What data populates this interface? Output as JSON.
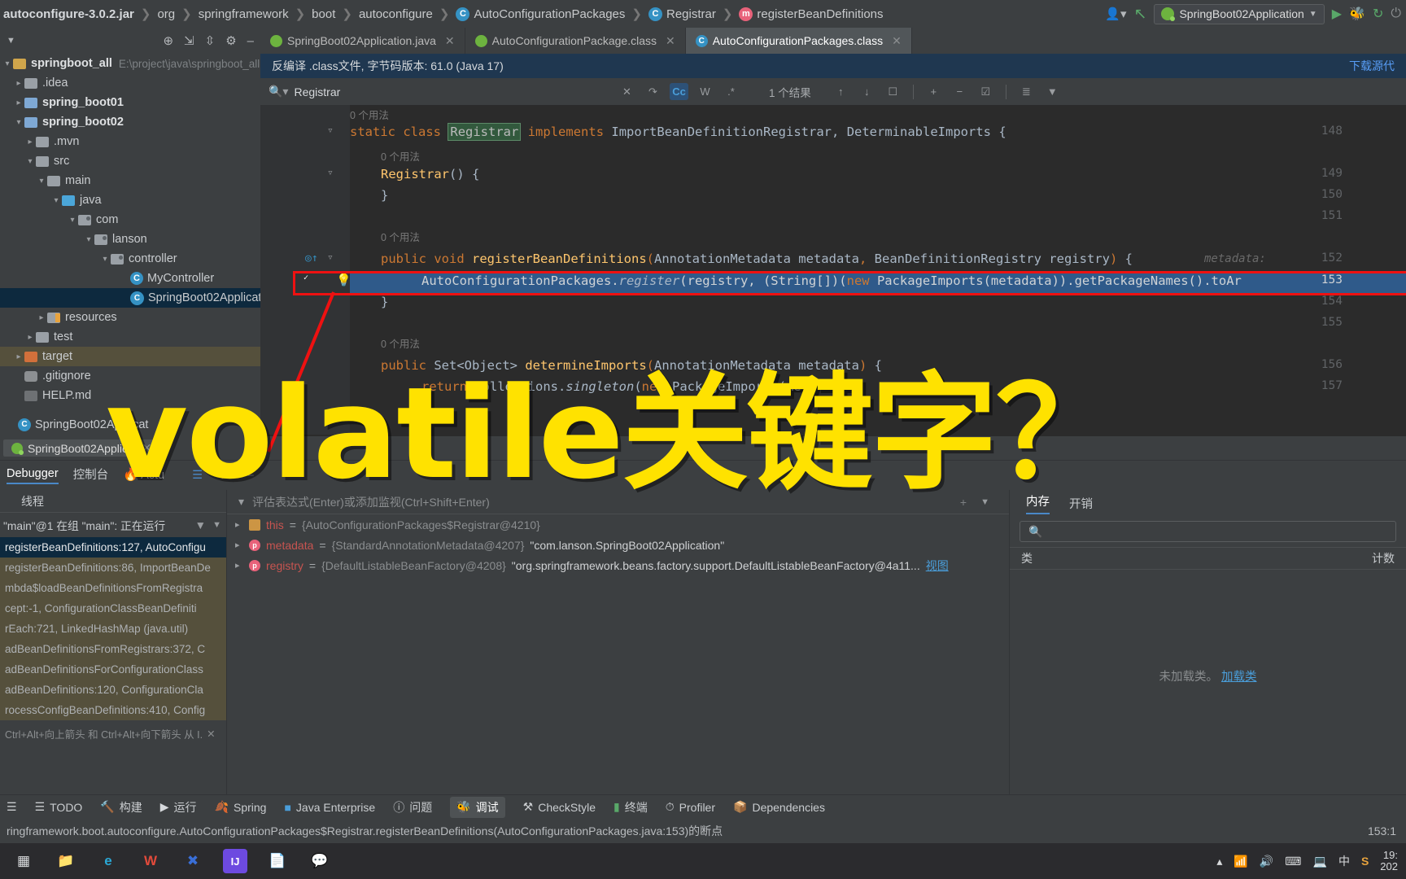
{
  "breadcrumb": [
    {
      "label": "autoconfigure-3.0.2.jar",
      "icon": "jar-icon",
      "bold": true
    },
    {
      "label": "org",
      "icon": "package-icon"
    },
    {
      "label": "springframework",
      "icon": "package-icon"
    },
    {
      "label": "boot",
      "icon": "package-icon"
    },
    {
      "label": "autoconfigure",
      "icon": "package-icon"
    },
    {
      "label": "AutoConfigurationPackages",
      "icon": "class-icon"
    },
    {
      "label": "Registrar",
      "icon": "class-icon"
    },
    {
      "label": "registerBeanDefinitions",
      "icon": "method-icon"
    }
  ],
  "topbar_right": {
    "profile_icon": "user-icon",
    "back_icon": "back-arrow-icon",
    "run_config": "SpringBoot02Application",
    "run_icon": "run-icon",
    "debug_icon": "debug-icon",
    "rerun_icon": "rerun-icon",
    "stop_icon": "stop-icon"
  },
  "tabs": [
    {
      "label": "SpringBoot02Application.java",
      "icon": "spring-class-icon",
      "active": false
    },
    {
      "label": "AutoConfigurationPackage.class",
      "icon": "annotation-icon",
      "active": false
    },
    {
      "label": "AutoConfigurationPackages.class",
      "icon": "class-icon",
      "active": true
    }
  ],
  "project_tree": {
    "toolbar_icons": [
      "collapse-icon",
      "scroll-from-source-icon",
      "expand-icon",
      "settings-gear-icon",
      "hide-icon"
    ],
    "items": [
      {
        "label": "springboot_all",
        "path": "E:\\project\\java\\springboot_all",
        "indent": 0,
        "arrow": "down",
        "icon": "project-icon",
        "bold": true
      },
      {
        "label": ".idea",
        "indent": 1,
        "arrow": "right",
        "icon": "folder-icon"
      },
      {
        "label": "spring_boot01",
        "indent": 1,
        "arrow": "right",
        "icon": "module-icon",
        "bold": true
      },
      {
        "label": "spring_boot02",
        "indent": 1,
        "arrow": "down",
        "icon": "module-icon",
        "bold": true
      },
      {
        "label": ".mvn",
        "indent": 2,
        "arrow": "right",
        "icon": "folder-icon"
      },
      {
        "label": "src",
        "indent": 2,
        "arrow": "down",
        "icon": "folder-icon"
      },
      {
        "label": "main",
        "indent": 3,
        "arrow": "down",
        "icon": "folder-icon"
      },
      {
        "label": "java",
        "indent": 4,
        "arrow": "down",
        "icon": "source-folder-icon"
      },
      {
        "label": "com",
        "indent": 5,
        "arrow": "down",
        "icon": "package-folder-icon"
      },
      {
        "label": "lanson",
        "indent": 6,
        "arrow": "down",
        "icon": "package-folder-icon"
      },
      {
        "label": "controller",
        "indent": 7,
        "arrow": "down",
        "icon": "package-folder-icon"
      },
      {
        "label": "MyController",
        "indent": 8,
        "arrow": "none",
        "icon": "class-icon"
      },
      {
        "label": "SpringBoot02Application",
        "indent": 8,
        "arrow": "none",
        "icon": "spring-class-icon",
        "selected": true
      },
      {
        "label": "resources",
        "indent": 4,
        "arrow": "right",
        "icon": "resources-folder-icon"
      },
      {
        "label": "test",
        "indent": 3,
        "arrow": "right",
        "icon": "test-folder-icon"
      },
      {
        "label": "target",
        "indent": 2,
        "arrow": "right",
        "icon": "target-folder-icon",
        "target": true
      },
      {
        "label": ".gitignore",
        "indent": 2,
        "arrow": "none",
        "icon": "gitignore-icon"
      },
      {
        "label": "HELP.md",
        "indent": 2,
        "arrow": "none",
        "icon": "markdown-icon"
      },
      {
        "label": "SpringBoot02Applicat",
        "indent": 2,
        "arrow": "none",
        "icon": "spring-class-icon"
      }
    ]
  },
  "editor": {
    "notification": "反编译 .class文件, 字节码版本: 61.0 (Java 17)",
    "notification_action": "下载源代",
    "find": {
      "value": "Registrar",
      "clear_icon": "close-icon",
      "history_icon": "history-icon",
      "match_case": "Cc",
      "words": "W",
      "regex": ".*",
      "result_count": "1 个结果",
      "prev_icon": "arrow-up-icon",
      "next_icon": "arrow-down-icon",
      "select_all_icon": "select-all-icon",
      "add_icon": "add-line-icon",
      "remove_icon": "remove-line-icon",
      "check_icon": "check-line-icon",
      "sort_icon": "sort-icon",
      "filter_icon": "filter-icon"
    },
    "usage_hint": "0 个用法",
    "lines": [
      {
        "n": "148",
        "text": "static class Registrar implements ImportBeanDefinitionRegistrar, DeterminableImports {",
        "fold": true
      },
      {
        "n": "149",
        "text": "Registrar() {",
        "fold": true
      },
      {
        "n": "150",
        "text": "}"
      },
      {
        "n": "151",
        "text": ""
      },
      {
        "n": "152",
        "text": "public void registerBeanDefinitions(AnnotationMetadata metadata, BeanDefinitionRegistry registry) {",
        "fold": true
      },
      {
        "n": "153",
        "text": "AutoConfigurationPackages.register(registry, (String[])(new PackageImports(metadata)).getPackageNames().toAr",
        "breakpoint": true,
        "current": true
      },
      {
        "n": "154",
        "text": "}"
      },
      {
        "n": "155",
        "text": ""
      },
      {
        "n": "156",
        "text": "public Set<Object> determineImports(AnnotationMetadata metadata) {"
      },
      {
        "n": "157",
        "text": "return Collections.singleton(new PackageImports(me"
      }
    ],
    "param_hint": "metadata:"
  },
  "debug": {
    "session_tab": "SpringBoot02Applicat",
    "tabs": [
      {
        "label": "Debugger",
        "active": true,
        "icon": "debugger-icon"
      },
      {
        "label": "控制台",
        "active": false,
        "icon": "console-icon"
      },
      {
        "label": "Actu",
        "active": false,
        "icon": "actuator-icon"
      }
    ],
    "toolbar_icons": [
      "layout-icon",
      "settings-icon",
      "mute-icon"
    ],
    "threads_header": "线程",
    "thread_selector": "\"main\"@1 在组 \"main\": 正在运行",
    "filter_icon": "filter-icon",
    "dropdown_icon": "chevron-down-icon",
    "frames": [
      {
        "text": "registerBeanDefinitions:127, AutoConfigu",
        "selected": true
      },
      {
        "text": "registerBeanDefinitions:86, ImportBeanDe",
        "dim": true
      },
      {
        "text": "mbda$loadBeanDefinitionsFromRegistra",
        "dim": true
      },
      {
        "text": "cept:-1, ConfigurationClassBeanDefiniti",
        "dim": true
      },
      {
        "text": "rEach:721, LinkedHashMap (java.util)",
        "dim": true
      },
      {
        "text": "adBeanDefinitionsFromRegistrars:372, C",
        "dim": true
      },
      {
        "text": "adBeanDefinitionsForConfigurationClass",
        "dim": true
      },
      {
        "text": "adBeanDefinitions:120, ConfigurationCla",
        "dim": true
      },
      {
        "text": "rocessConfigBeanDefinitions:410, Config",
        "dim": true
      }
    ],
    "frames_hint": "Ctrl+Alt+向上箭头 和 Ctrl+Alt+向下箭头 从 I.",
    "eval_placeholder": "评估表达式(Enter)或添加监视(Ctrl+Shift+Enter)",
    "variables": [
      {
        "name": "this",
        "icon": "field-icon",
        "value": "{AutoConfigurationPackages$Registrar@4210}",
        "extra": ""
      },
      {
        "name": "metadata",
        "icon": "parameter-icon",
        "value": "{StandardAnnotationMetadata@4207}",
        "extra": "\"com.lanson.SpringBoot02Application\""
      },
      {
        "name": "registry",
        "icon": "parameter-icon",
        "value": "{DefaultListableBeanFactory@4208}",
        "extra": "\"org.springframework.beans.factory.support.DefaultListableBeanFactory@4a11...",
        "link": "视图"
      }
    ],
    "memory": {
      "tabs": [
        {
          "label": "内存",
          "active": true
        },
        {
          "label": "开销",
          "active": false
        }
      ],
      "search_icon": "search-icon",
      "col_class": "类",
      "col_count": "计数",
      "empty_text": "未加载类。",
      "empty_link": "加载类"
    }
  },
  "bottom_tools": [
    {
      "label": "TODO",
      "icon": "todo-icon"
    },
    {
      "label": "构建",
      "icon": "build-icon"
    },
    {
      "label": "运行",
      "icon": "run-icon"
    },
    {
      "label": "Spring",
      "icon": "spring-icon"
    },
    {
      "label": "Java Enterprise",
      "icon": "java-ee-icon"
    },
    {
      "label": "问题",
      "icon": "problems-icon"
    },
    {
      "label": "调试",
      "icon": "debug-icon",
      "active": true
    },
    {
      "label": "CheckStyle",
      "icon": "checkstyle-icon"
    },
    {
      "label": "终端",
      "icon": "terminal-icon"
    },
    {
      "label": "Profiler",
      "icon": "profiler-icon"
    },
    {
      "label": "Dependencies",
      "icon": "dependencies-icon"
    }
  ],
  "status_bar": {
    "message": "ringframework.boot.autoconfigure.AutoConfigurationPackages$Registrar.registerBeanDefinitions(AutoConfigurationPackages.java:153)的断点",
    "caret": "153:1"
  },
  "taskbar": {
    "items": [
      {
        "name": "start-icon",
        "glyph": "⊞",
        "color": "#d8dadc",
        "bg": "transparent"
      },
      {
        "name": "file-explorer-icon",
        "glyph": "📁",
        "color": "#f0b429",
        "bg": "transparent"
      },
      {
        "name": "browser-icon",
        "glyph": "e",
        "color": "#2ba8d6",
        "bg": "transparent"
      },
      {
        "name": "wps-icon",
        "glyph": "W",
        "color": "#e24a3b",
        "bg": "transparent"
      },
      {
        "name": "xmind-icon",
        "glyph": "✕",
        "color": "#3a6fd8",
        "bg": "transparent"
      },
      {
        "name": "intellij-idea-icon",
        "glyph": "IJ",
        "color": "#ffffff",
        "bg": "#6d4ae0"
      },
      {
        "name": "notepad-icon",
        "glyph": "📄",
        "color": "#9aa0a6",
        "bg": "transparent"
      },
      {
        "name": "wechat-icon",
        "glyph": "💬",
        "color": "#2dc100",
        "bg": "transparent"
      }
    ],
    "tray": [
      "chevron-up-icon",
      "wifi-icon",
      "volume-icon",
      "keyboard-icon",
      "monitor-icon",
      "ime-cn-icon",
      "sogou-icon"
    ],
    "clock_time": "19:",
    "clock_date": "202"
  },
  "overlay": {
    "text": "volatile关键字？",
    "color": "#ffe200"
  },
  "colors": {
    "accent": "#4a88c7",
    "breakpoint": "#c75450",
    "highlight_line": "#2f5a8a",
    "callout_red": "#ee1111",
    "overlay_yellow": "#ffe200"
  }
}
